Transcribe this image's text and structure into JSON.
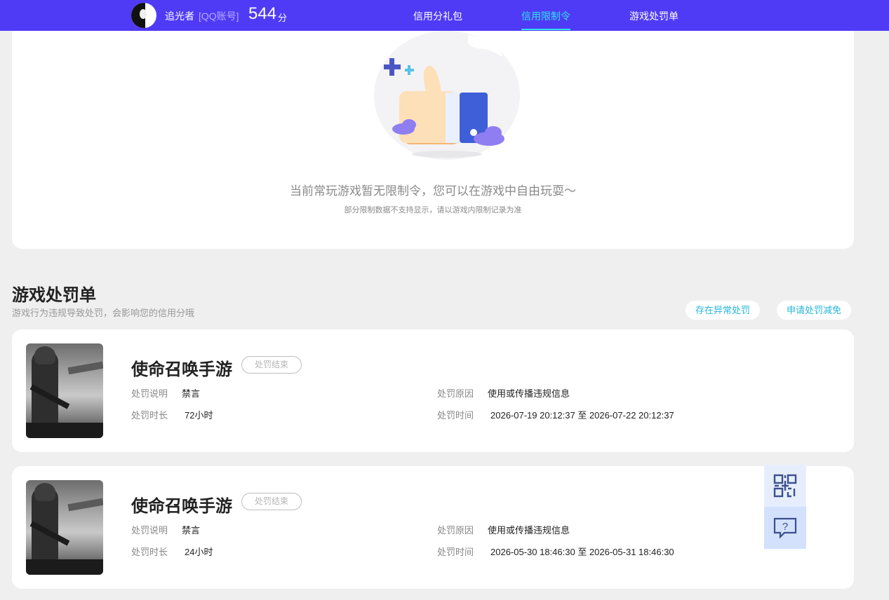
{
  "header": {
    "username": "追光者",
    "account_type": "[QQ账号]",
    "score": "544",
    "score_unit": "分",
    "tabs": [
      {
        "label": "信用分礼包",
        "active": false
      },
      {
        "label": "信用限制令",
        "active": true
      },
      {
        "label": "游戏处罚单",
        "active": false
      }
    ],
    "accent_color": "#4f3bf6",
    "active_tab_color": "#31e2f0"
  },
  "restriction": {
    "empty_title": "当前常玩游戏暂无限制令，您可以在游戏中自由玩耍～",
    "empty_subtitle": "部分限制数据不支持显示，请以游戏内限制记录为准",
    "illustration": "thumbs-up-icon"
  },
  "penalty_section": {
    "title": "游戏处罚单",
    "subtitle": "游戏行为违规导致处罚，会影响您的信用分哦",
    "buttons": {
      "abnormal": "存在异常处罚",
      "appeal": "申请处罚减免"
    }
  },
  "penalties": [
    {
      "game_name": "使命召唤手游",
      "status": "处罚结束",
      "desc_label": "处罚说明",
      "desc_value": "禁言",
      "duration_label": "处罚时长",
      "duration_value": "72小时",
      "reason_label": "处罚原因",
      "reason_value": "使用或传播违规信息",
      "time_label": "处罚时间",
      "time_value": "2026-07-19 20:12:37 至 2026-07-22 20:12:37"
    },
    {
      "game_name": "使命召唤手游",
      "status": "处罚结束",
      "desc_label": "处罚说明",
      "desc_value": "禁言",
      "duration_label": "处罚时长",
      "duration_value": "24小时",
      "reason_label": "处罚原因",
      "reason_value": "使用或传播违规信息",
      "time_label": "处罚时间",
      "time_value": "2026-05-30 18:46:30 至 2026-05-31 18:46:30"
    }
  ],
  "floating": {
    "qr_icon": "qr-code-icon",
    "help_icon": "help-chat-icon"
  }
}
